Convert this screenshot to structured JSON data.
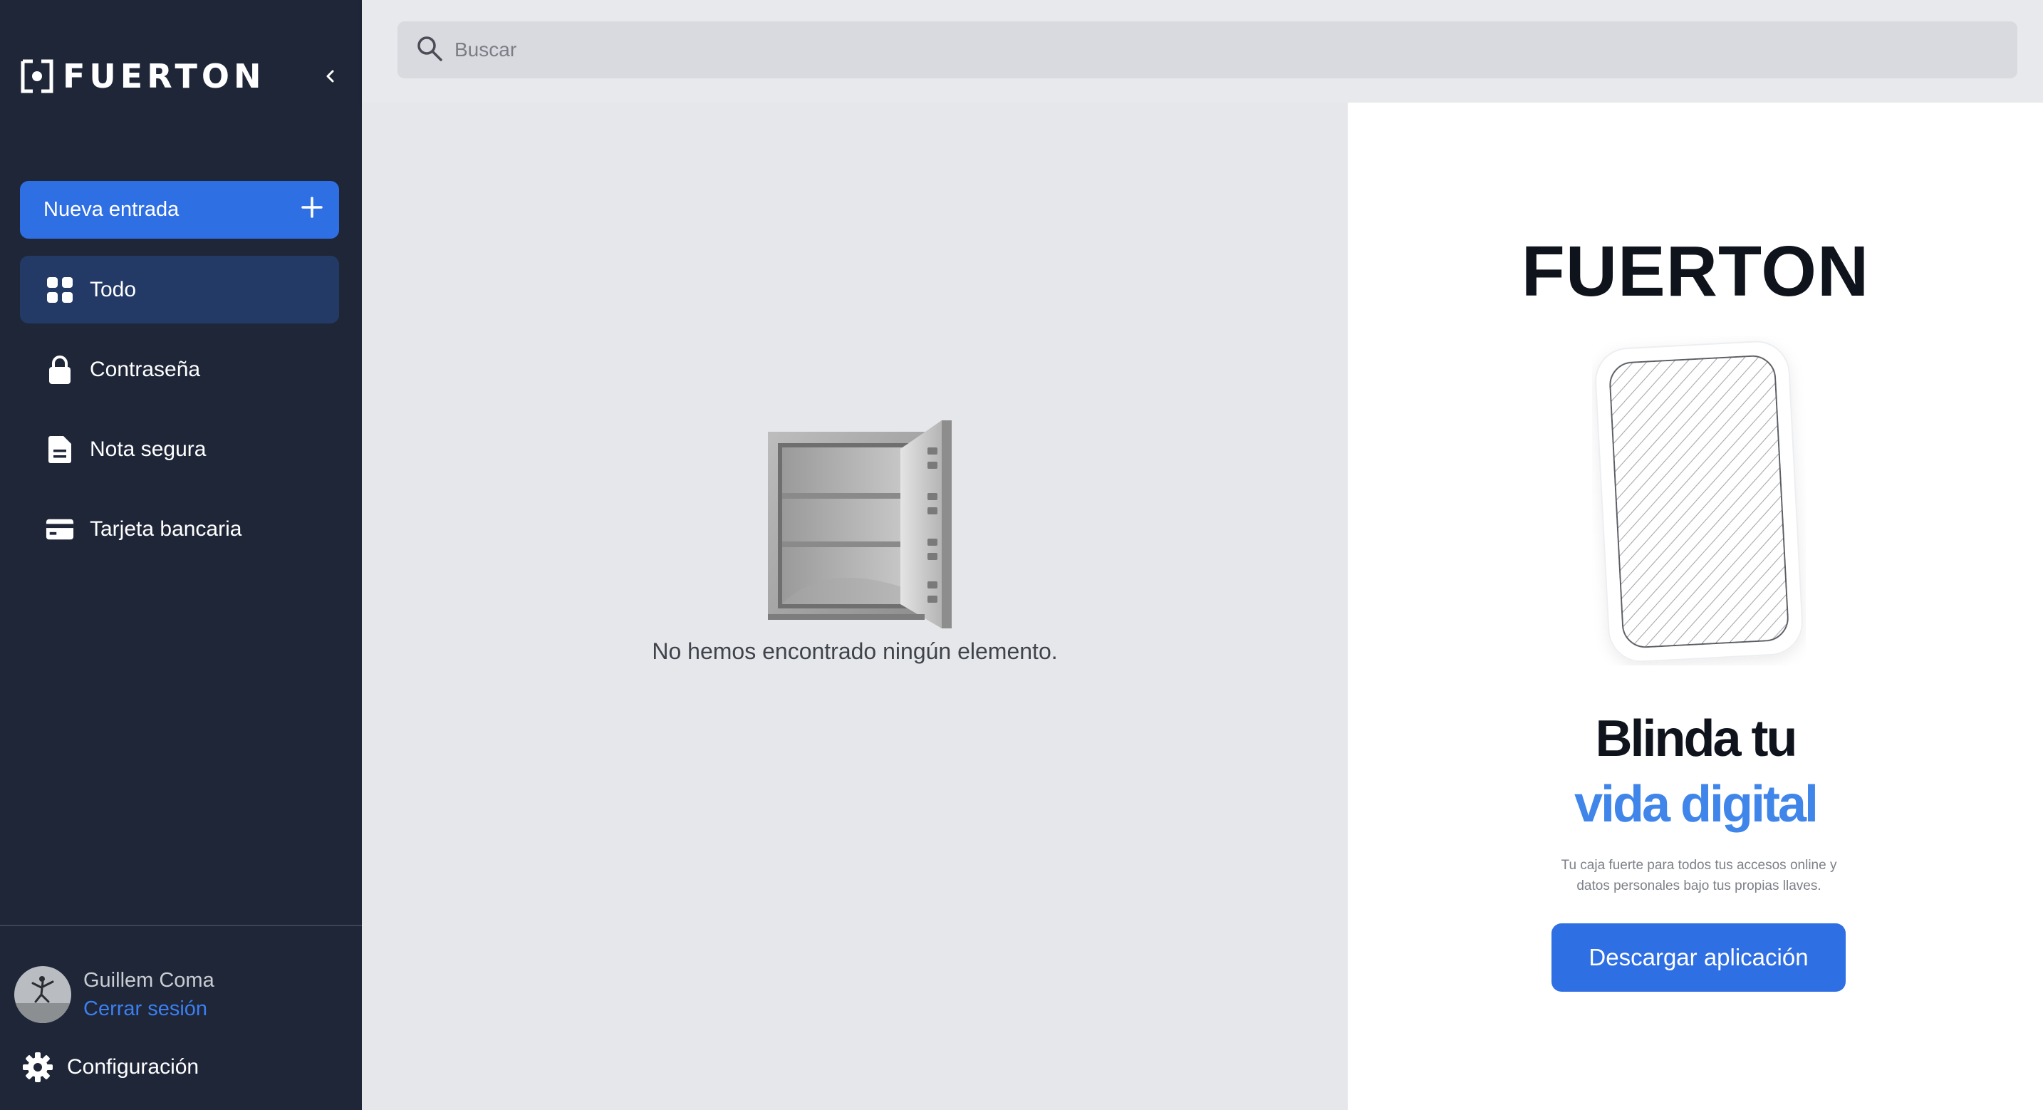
{
  "brand": {
    "name": "FUERTON"
  },
  "sidebar": {
    "new_entry_label": "Nueva entrada",
    "items": [
      {
        "label": "Todo",
        "icon": "grid-icon",
        "active": true
      },
      {
        "label": "Contraseña",
        "icon": "lock-icon",
        "active": false
      },
      {
        "label": "Nota segura",
        "icon": "document-icon",
        "active": false
      },
      {
        "label": "Tarjeta bancaria",
        "icon": "credit-card-icon",
        "active": false
      }
    ],
    "user": {
      "name": "Guillem Coma",
      "logout_label": "Cerrar sesión"
    },
    "settings_label": "Configuración"
  },
  "search": {
    "placeholder": "Buscar",
    "value": ""
  },
  "main": {
    "empty_message": "No hemos encontrado ningún elemento."
  },
  "promo": {
    "brand": "FUERTON",
    "headline_line1": "Blinda tu",
    "headline_line2": "vida digital",
    "subtitle_line1": "Tu caja fuerte para todos tus accesos online y",
    "subtitle_line2": "datos personales bajo tus propias llaves.",
    "button_label": "Descargar aplicación"
  },
  "colors": {
    "sidebar_bg": "#1e2638",
    "accent": "#2f6fe4",
    "active_item_bg": "#233a67",
    "link": "#3b7ff0",
    "headline_accent": "#3f85ea"
  }
}
